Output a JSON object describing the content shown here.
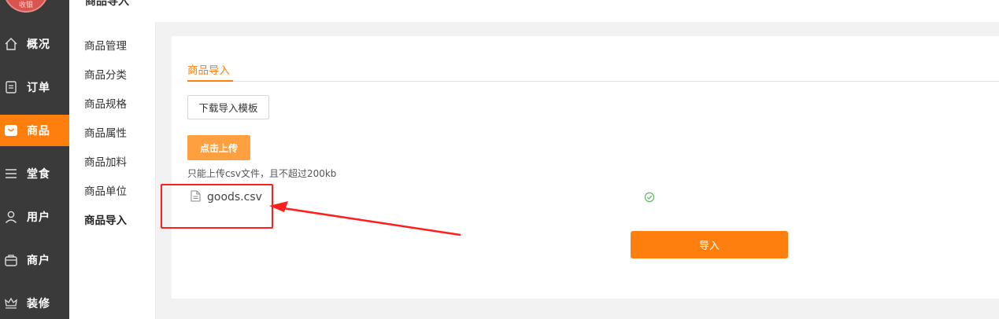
{
  "header": {
    "title": "商品导入"
  },
  "logo": {
    "text": "收银"
  },
  "nav": {
    "items": [
      {
        "label": "概况",
        "icon": "home-icon"
      },
      {
        "label": "订单",
        "icon": "order-list-icon"
      },
      {
        "label": "商品",
        "icon": "bag-icon",
        "active": true
      },
      {
        "label": "堂食",
        "icon": "menu-lines-icon"
      },
      {
        "label": "用户",
        "icon": "user-icon"
      },
      {
        "label": "商户",
        "icon": "store-icon"
      },
      {
        "label": "装修",
        "icon": "crown-icon"
      }
    ]
  },
  "subnav": {
    "items": [
      {
        "label": "商品管理"
      },
      {
        "label": "商品分类"
      },
      {
        "label": "商品规格"
      },
      {
        "label": "商品属性"
      },
      {
        "label": "商品加料"
      },
      {
        "label": "商品单位"
      },
      {
        "label": "商品导入",
        "active": true
      }
    ]
  },
  "main": {
    "tab_label": "商品导入",
    "download_button": "下载导入模板",
    "upload_button": "点击上传",
    "upload_hint": "只能上传csv文件，且不超过200kb",
    "file": {
      "name": "goods.csv",
      "status_icon": "check-circle-icon"
    },
    "import_button": "导入"
  },
  "colors": {
    "accent": "#ff7f0e",
    "upload": "#ffa040",
    "nav_bg": "#3a3a3a",
    "annotation": "#ff1e1e",
    "success": "#5cb85c"
  }
}
